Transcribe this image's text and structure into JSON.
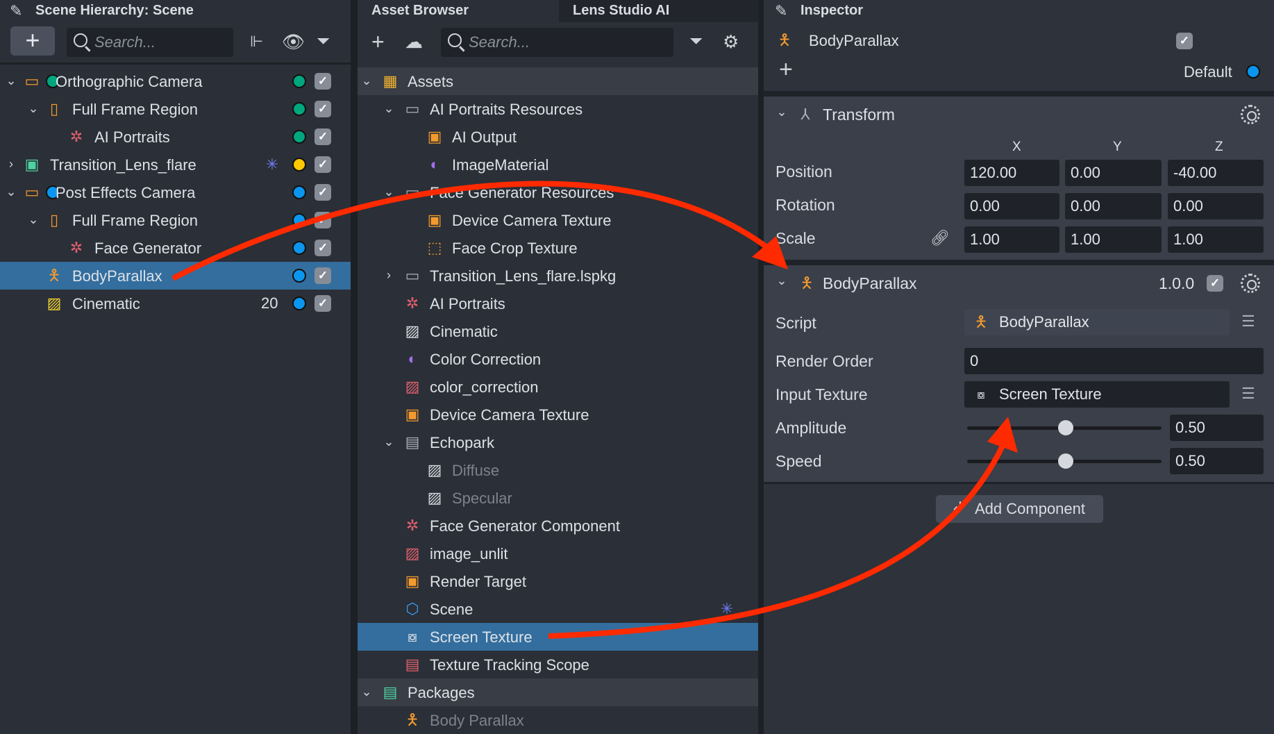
{
  "hierarchy": {
    "title": "Scene Hierarchy: Scene",
    "search_placeholder": "Search...",
    "rows": [
      {
        "label": "Orthographic Camera",
        "depth": 0,
        "chevron": "expanded",
        "icon": "camera-icon",
        "layer_dot": "#00a67e",
        "status": "#00a67e"
      },
      {
        "label": "Full Frame Region",
        "depth": 1,
        "chevron": "expanded",
        "icon": "device-frame-icon",
        "status": "#00a67e"
      },
      {
        "label": "AI Portraits",
        "depth": 2,
        "icon": "face-generator-icon",
        "status": "#00a67e"
      },
      {
        "label": "Transition_Lens_flare",
        "depth": 0,
        "chevron": "collapsed",
        "icon": "package-box-icon",
        "sparkle": true,
        "status": "#ffc800"
      },
      {
        "label": "Post Effects Camera",
        "depth": 0,
        "chevron": "expanded",
        "icon": "camera-icon",
        "layer_dot": "#0a96ef",
        "status": "#0a96ef"
      },
      {
        "label": "Full Frame Region",
        "depth": 1,
        "chevron": "expanded",
        "icon": "device-frame-icon",
        "status": "#0a96ef"
      },
      {
        "label": "Face Generator",
        "depth": 2,
        "icon": "face-generator-icon",
        "status": "#0a96ef"
      },
      {
        "label": "BodyParallax",
        "depth": 1,
        "icon": "body-figure-icon",
        "status": "#0a96ef",
        "selected": true
      },
      {
        "label": "Cinematic",
        "depth": 1,
        "icon": "cinematic-icon",
        "status": "#0a96ef",
        "count": "20"
      }
    ]
  },
  "assets": {
    "tabs": [
      "Asset Browser",
      "Lens Studio AI"
    ],
    "search_placeholder": "Search...",
    "rows": [
      {
        "label": "Assets",
        "depth": 0,
        "chevron": "expanded",
        "icon": "assets-folder-icon",
        "header": true
      },
      {
        "label": "AI Portraits Resources",
        "depth": 1,
        "chevron": "expanded",
        "icon": "folder-icon"
      },
      {
        "label": "AI Output",
        "depth": 2,
        "icon": "render-target-icon"
      },
      {
        "label": "ImageMaterial",
        "depth": 2,
        "icon": "material-icon"
      },
      {
        "label": "Face Generator Resources",
        "depth": 1,
        "chevron": "expanded",
        "icon": "folder-icon"
      },
      {
        "label": "Device Camera Texture",
        "depth": 2,
        "icon": "camera-texture-icon"
      },
      {
        "label": "Face Crop Texture",
        "depth": 2,
        "icon": "face-crop-icon"
      },
      {
        "label": "Transition_Lens_flare.lspkg",
        "depth": 1,
        "chevron": "collapsed",
        "icon": "folder-icon"
      },
      {
        "label": "AI Portraits",
        "depth": 1,
        "icon": "face-generator-icon"
      },
      {
        "label": "Cinematic",
        "depth": 1,
        "icon": "image-icon"
      },
      {
        "label": "Color Correction",
        "depth": 1,
        "icon": "material-icon"
      },
      {
        "label": "color_correction",
        "depth": 1,
        "icon": "texture-icon"
      },
      {
        "label": "Device Camera Texture",
        "depth": 1,
        "icon": "camera-texture-icon"
      },
      {
        "label": "Echopark",
        "depth": 1,
        "chevron": "expanded",
        "icon": "hdr-icon"
      },
      {
        "label": "Diffuse",
        "depth": 2,
        "icon": "image-icon",
        "dim": true
      },
      {
        "label": "Specular",
        "depth": 2,
        "icon": "image-icon",
        "dim": true
      },
      {
        "label": "Face Generator Component",
        "depth": 1,
        "icon": "face-generator-icon"
      },
      {
        "label": "image_unlit",
        "depth": 1,
        "icon": "texture-icon"
      },
      {
        "label": "Render Target",
        "depth": 1,
        "icon": "render-target-icon"
      },
      {
        "label": "Scene",
        "depth": 1,
        "icon": "scene-icon",
        "sparkle": true
      },
      {
        "label": "Screen Texture",
        "depth": 1,
        "icon": "screen-texture-icon",
        "selected": true
      },
      {
        "label": "Texture Tracking Scope",
        "depth": 1,
        "icon": "tracking-scope-icon"
      },
      {
        "label": "Packages",
        "depth": 0,
        "chevron": "expanded",
        "icon": "packages-icon",
        "header": true
      },
      {
        "label": "Body Parallax",
        "depth": 1,
        "icon": "body-figure-icon",
        "dim": true
      }
    ]
  },
  "inspector": {
    "title": "Inspector",
    "object_name": "BodyParallax",
    "layer": "Default",
    "transform": {
      "title": "Transform",
      "axes": [
        "X",
        "Y",
        "Z"
      ],
      "position_label": "Position",
      "position": [
        "120.00",
        "0.00",
        "-40.00"
      ],
      "rotation_label": "Rotation",
      "rotation": [
        "0.00",
        "0.00",
        "0.00"
      ],
      "scale_label": "Scale",
      "scale": [
        "1.00",
        "1.00",
        "1.00"
      ]
    },
    "component": {
      "title": "BodyParallax",
      "version": "1.0.0",
      "script_label": "Script",
      "script_value": "BodyParallax",
      "render_order_label": "Render Order",
      "render_order": "0",
      "input_texture_label": "Input Texture",
      "input_texture": "Screen Texture",
      "amplitude_label": "Amplitude",
      "amplitude": "0.50",
      "speed_label": "Speed",
      "speed": "0.50"
    },
    "add_component": "Add Component"
  },
  "colors": {
    "accent": "#336e9e",
    "arrow": "#ff2a00"
  }
}
